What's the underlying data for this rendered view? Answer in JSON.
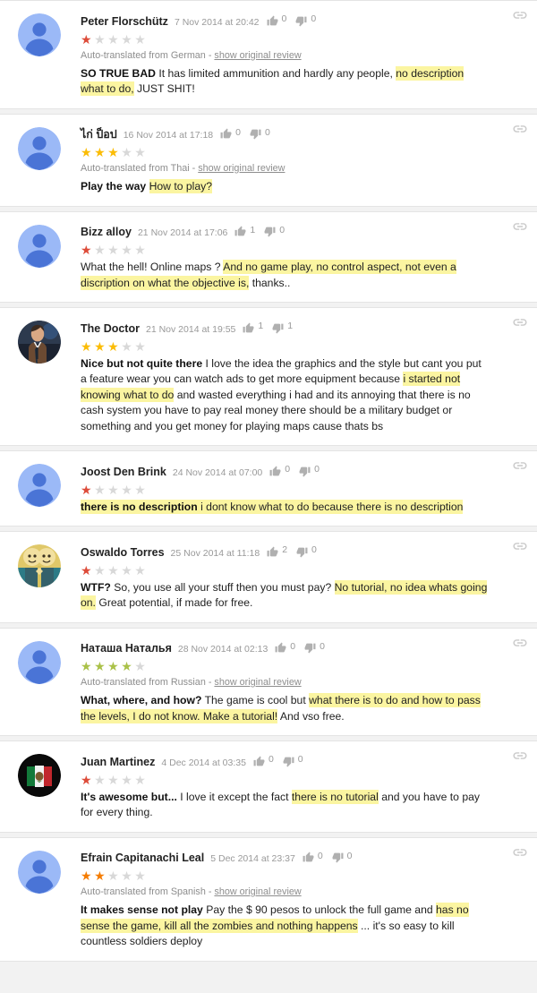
{
  "page": {
    "background_color": "#f2f2f2",
    "card_background": "#ffffff",
    "highlight_color": "#fbf5a1"
  },
  "icons": {
    "link": "link-icon",
    "thumbs_up": "thumbs-up-icon",
    "thumbs_down": "thumbs-down-icon"
  },
  "star_colors": {
    "1": "#dd4b39",
    "2": "#f57c00",
    "3": "#fbbc05",
    "4": "#aac148",
    "5": "#4caf50",
    "empty": "#d8d8d8"
  },
  "labels": {
    "show_original": "show original review",
    "translated_prefix": "Auto-translated from",
    "separator": "-"
  },
  "reviews": [
    {
      "author": "Peter Florschütz",
      "timestamp": "7 Nov 2014 at 20:42",
      "thumbs_up": "0",
      "thumbs_down": "0",
      "rating": 1,
      "translated_from": "German",
      "translation_note": "Auto-translated from German -",
      "title": "SO TRUE BAD",
      "avatar_type": "default",
      "text_parts": [
        {
          "text": " It has limited ammunition and hardly any people, ",
          "highlight": false
        },
        {
          "text": "no description what to do,",
          "highlight": true
        },
        {
          "text": " JUST SHIT!",
          "highlight": false
        }
      ]
    },
    {
      "author": "ไก่ ป็อป",
      "timestamp": "16 Nov 2014 at 17:18",
      "thumbs_up": "0",
      "thumbs_down": "0",
      "rating": 3,
      "translated_from": "Thai",
      "translation_note": "Auto-translated from Thai -",
      "title": "Play the way",
      "avatar_type": "default",
      "text_parts": [
        {
          "text": " ",
          "highlight": false
        },
        {
          "text": "How to play?",
          "highlight": true
        }
      ]
    },
    {
      "author": "Bizz alloy",
      "timestamp": "21 Nov 2014 at 17:06",
      "thumbs_up": "1",
      "thumbs_down": "0",
      "rating": 1,
      "translated_from": null,
      "translation_note": null,
      "title": null,
      "avatar_type": "default",
      "text_parts": [
        {
          "text": "What the hell! Online maps ? ",
          "highlight": false
        },
        {
          "text": "And no game play, no control aspect, not even a discription on what the objective is,",
          "highlight": true
        },
        {
          "text": " thanks..",
          "highlight": false
        }
      ]
    },
    {
      "author": "The Doctor",
      "timestamp": "21 Nov 2014 at 19:55",
      "thumbs_up": "1",
      "thumbs_down": "1",
      "rating": 3,
      "translated_from": null,
      "translation_note": null,
      "title": "Nice but not quite there",
      "avatar_type": "photo-doctor",
      "text_parts": [
        {
          "text": " I love the idea the graphics and the style but cant you put a feature wear you can watch ads to get more equipment because ",
          "highlight": false
        },
        {
          "text": "i started not knowing what to do",
          "highlight": true
        },
        {
          "text": " and wasted everything i had and its annoying that there is no cash system you have to pay real money there should be a military budget or something and you get money for playing maps cause thats bs",
          "highlight": false
        }
      ]
    },
    {
      "author": "Joost Den Brink",
      "timestamp": "24 Nov 2014 at 07:00",
      "thumbs_up": "0",
      "thumbs_down": "0",
      "rating": 1,
      "translated_from": null,
      "translation_note": null,
      "title": "there is no description",
      "title_highlighted": true,
      "avatar_type": "default",
      "text_parts": [
        {
          "text": " i dont know what to do because there is no description",
          "highlight": true
        }
      ]
    },
    {
      "author": "Oswaldo Torres",
      "timestamp": "25 Nov 2014 at 11:18",
      "thumbs_up": "2",
      "thumbs_down": "0",
      "rating": 1,
      "translated_from": null,
      "translation_note": null,
      "title": "WTF?",
      "avatar_type": "photo-vault",
      "text_parts": [
        {
          "text": " So, you use all your stuff then you must pay? ",
          "highlight": false
        },
        {
          "text": "No tutorial, no idea whats going on.",
          "highlight": true
        },
        {
          "text": " Great potential, if made for free.",
          "highlight": false
        }
      ]
    },
    {
      "author": "Наташа Наталья",
      "timestamp": "28 Nov 2014 at 02:13",
      "thumbs_up": "0",
      "thumbs_down": "0",
      "rating": 4,
      "translated_from": "Russian",
      "translation_note": "Auto-translated from Russian -",
      "title": "What, where, and how?",
      "avatar_type": "default",
      "text_parts": [
        {
          "text": " The game is cool but ",
          "highlight": false
        },
        {
          "text": "what there is to do and how to pass the levels, I do not know. Make a tutorial!",
          "highlight": true
        },
        {
          "text": " And vso free.",
          "highlight": false
        }
      ]
    },
    {
      "author": "Juan Martinez",
      "timestamp": "4 Dec 2014 at 03:35",
      "thumbs_up": "0",
      "thumbs_down": "0",
      "rating": 1,
      "translated_from": null,
      "translation_note": null,
      "title": "It's awesome but...",
      "avatar_type": "photo-flag",
      "text_parts": [
        {
          "text": " I love it except the fact ",
          "highlight": false
        },
        {
          "text": "there is no tutorial",
          "highlight": true
        },
        {
          "text": " and you have to pay for every thing.",
          "highlight": false
        }
      ]
    },
    {
      "author": "Efrain Capitanachi Leal",
      "timestamp": "5 Dec 2014 at 23:37",
      "thumbs_up": "0",
      "thumbs_down": "0",
      "rating": 2,
      "translated_from": "Spanish",
      "translation_note": "Auto-translated from Spanish -",
      "title": "It makes sense not play",
      "avatar_type": "default",
      "text_parts": [
        {
          "text": " Pay the $ 90 pesos to unlock the full game and ",
          "highlight": false
        },
        {
          "text": "has no sense the game, kill all the zombies and nothing happens",
          "highlight": true
        },
        {
          "text": " ... it's so easy to kill countless soldiers deploy",
          "highlight": false
        }
      ]
    }
  ]
}
